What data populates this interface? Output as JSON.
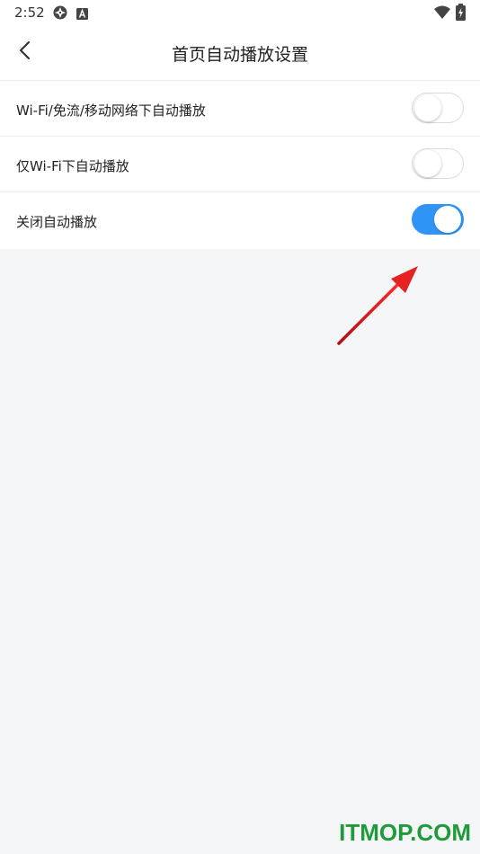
{
  "status_bar": {
    "time": "2:52",
    "icons": [
      "sync-icon",
      "a-badge-icon",
      "wifi-icon",
      "battery-charging-icon"
    ]
  },
  "header": {
    "title": "首页自动播放设置",
    "back_icon": "chevron-left-icon"
  },
  "settings": [
    {
      "label": "Wi-Fi/免流/移动网络下自动播放",
      "enabled": false
    },
    {
      "label": "仅Wi-Fi下自动播放",
      "enabled": false
    },
    {
      "label": "关闭自动播放",
      "enabled": true
    }
  ],
  "colors": {
    "toggle_on": "#2f94f5",
    "annotation_arrow": "#e02020",
    "watermark": "#1f9a3a"
  },
  "watermark": "ITMOP.COM"
}
